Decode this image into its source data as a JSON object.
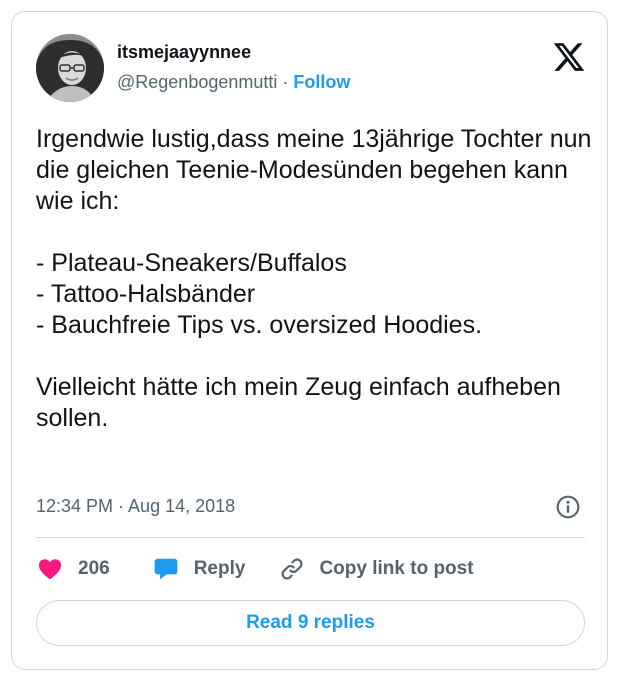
{
  "author": {
    "display_name": "itsmejaayynnee",
    "handle": "@Regenbogenmutti",
    "separator": "·",
    "follow_label": "Follow"
  },
  "tweet": {
    "text": "Irgendwie lustig,dass meine 13jährige Tochter nun die gleichen Teenie-Modesünden begehen kann wie ich:\n\n- Plateau-Sneakers/Buffalos\n- Tattoo-Halsbänder\n- Bauchfreie Tips vs. oversized Hoodies.\n\nVielleicht hätte ich mein Zeug einfach aufheben sollen.",
    "timestamp": "12:34 PM · Aug 14, 2018"
  },
  "actions": {
    "like_count": "206",
    "reply_label": "Reply",
    "copy_link_label": "Copy link to post"
  },
  "read_replies_label": "Read 9 replies",
  "icons": {
    "logo": "x-logo-icon",
    "info": "info-icon",
    "like": "heart-icon",
    "reply": "speech-bubble-icon",
    "copy": "link-icon"
  },
  "colors": {
    "accent": "#1d9bf0",
    "like": "#f91880",
    "text": "#0f1419",
    "secondary": "#536471",
    "border": "#cfd9de"
  }
}
